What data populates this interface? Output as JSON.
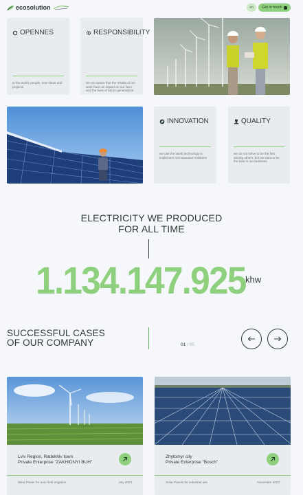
{
  "header": {
    "logo_text": "ecosolution",
    "lang_label": "en",
    "cta_label": "Get in touch"
  },
  "values": [
    {
      "title": "OPENNES",
      "icon": "refresh-icon",
      "text": "to the world, people, new ideas and projects"
    },
    {
      "title": "RESPONSIBILITY",
      "icon": "gear-icon",
      "text": "we are aware that the results of our work have an impact on our lives and the lives of future generations"
    },
    {
      "title": "INNOVATION",
      "icon": "leaf-circle-icon",
      "text": "we use the latest technology to implement non-standard solutions"
    },
    {
      "title": "QUALITY",
      "icon": "trophy-icon",
      "text": "we do not strive to be the first among others, but we want to be the best in our business"
    }
  ],
  "stats": {
    "title_line1": "ELECTRICITY WE PRODUCED",
    "title_line2": "FOR ALL TIME",
    "value": "1.134.147.925",
    "unit": "khw"
  },
  "cases": {
    "title_line1": "SUCCESSFUL CASES",
    "title_line2": "OF OUR COMPANY",
    "pager_current": "01",
    "pager_sep": " / ",
    "pager_total": "05",
    "items": [
      {
        "region": "Lviv Region, Radekhiv town",
        "company": "Private Enterprise \"ZAKHIDNYI BUH\"",
        "desc": "Wind Power for auto field irrigation",
        "date": "July 2023"
      },
      {
        "region": "Zhytomyr city",
        "company": "Private Enterprise \"Bosch\"",
        "desc": "Solar Panels for industrial use",
        "date": "November 2023"
      }
    ]
  },
  "colors": {
    "accent": "#8fd07f",
    "dark": "#2b3a34",
    "card": "#e9ecef",
    "background": "#f6f7fb"
  }
}
